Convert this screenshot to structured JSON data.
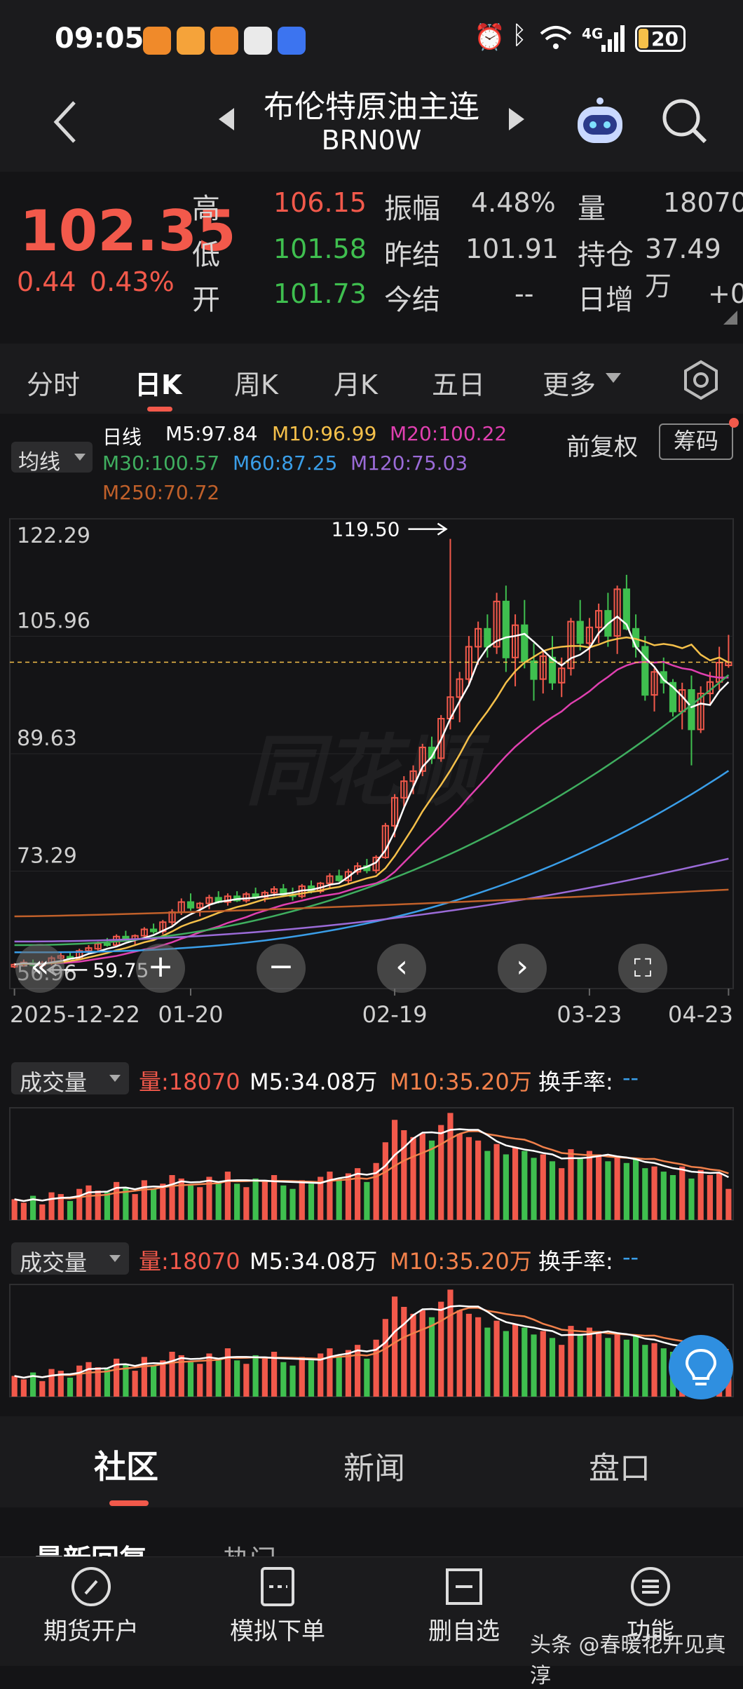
{
  "status_bar": {
    "time": "09:05",
    "network": "4G",
    "battery": "20"
  },
  "header": {
    "title": "布伦特原油主连",
    "code": "BRN0W"
  },
  "quote": {
    "price": "102.35",
    "change": "0.44",
    "change_pct": "0.43%",
    "high_label": "高",
    "high": "106.15",
    "low_label": "低",
    "low": "101.58",
    "open_label": "开",
    "open": "101.73",
    "amplitude_label": "振幅",
    "amplitude": "4.48%",
    "prev_settle_label": "昨结",
    "prev_settle": "101.91",
    "settle_label": "今结",
    "settle": "--",
    "volume_label": "量",
    "volume": "18070",
    "oi_label": "持仓",
    "oi": "37.49万",
    "daily_inc_label": "日增",
    "daily_inc": "+0"
  },
  "tabs": [
    "分时",
    "日K",
    "周K",
    "月K",
    "五日",
    "更多"
  ],
  "active_tab": "日K",
  "chart_controls": {
    "ma_select": "均线",
    "period": "日线",
    "adjust": "前复权",
    "chips": "筹码"
  },
  "ma_legend": {
    "m5": "M5:97.84",
    "m10": "M10:96.99",
    "m20": "M20:100.22",
    "m30": "M30:100.57",
    "m60": "M60:87.25",
    "m120": "M120:75.03",
    "m250": "M250:70.72"
  },
  "colors": {
    "up": "#f2594b",
    "down": "#3fbf4f",
    "m5": "#ffffff",
    "m10": "#f5c04a",
    "m20": "#e040b0",
    "m30": "#3fae5f",
    "m60": "#3a9ee8",
    "m120": "#9b6bd8",
    "m250": "#c0602a"
  },
  "watermark": "同花顺",
  "price_axis": {
    "ticks": [
      "122.29",
      "105.96",
      "89.63",
      "73.29",
      "56.96"
    ]
  },
  "annotations": {
    "max": "119.50",
    "min": "59.75"
  },
  "date_axis": [
    "2025-12-22",
    "01-20",
    "02-19",
    "03-23",
    "04-23"
  ],
  "volume_panel": {
    "label": "成交量",
    "vol": "量:18070",
    "m5": "M5:34.08万",
    "m10": "M10:35.20万",
    "turnover_label": "换手率:",
    "turnover": "--"
  },
  "chart_data": {
    "type": "candlestick",
    "y_range": [
      56.96,
      122.29
    ],
    "x_ticks": [
      "2025-12-22",
      "01-20",
      "02-19",
      "03-23",
      "04-23"
    ],
    "candles": [
      [
        60,
        60.5,
        59.8,
        60.3
      ],
      [
        60.3,
        61,
        60,
        60.6
      ],
      [
        60.5,
        61,
        60,
        60.2
      ],
      [
        60.2,
        60.8,
        59.75,
        60.5
      ],
      [
        60.5,
        61.5,
        60.2,
        61.2
      ],
      [
        61.2,
        62,
        60.8,
        61.5
      ],
      [
        61.4,
        62,
        61,
        61.1
      ],
      [
        61.1,
        62.5,
        61,
        62.2
      ],
      [
        62.2,
        63,
        61.8,
        62.6
      ],
      [
        62.5,
        63.5,
        62.2,
        63.2
      ],
      [
        63.2,
        64,
        62.8,
        63
      ],
      [
        63,
        64.5,
        62.8,
        64.2
      ],
      [
        64.2,
        65,
        63.5,
        63.8
      ],
      [
        63.8,
        64.5,
        63,
        64.3
      ],
      [
        64.3,
        65.5,
        64,
        65.2
      ],
      [
        65.2,
        66,
        64.6,
        64.9
      ],
      [
        64.9,
        66.5,
        64.5,
        66.2
      ],
      [
        66.2,
        68,
        65.8,
        67.6
      ],
      [
        67.6,
        69.5,
        67.2,
        69
      ],
      [
        69,
        70.2,
        67.8,
        68.2
      ],
      [
        68.2,
        69,
        67,
        68.8
      ],
      [
        68.8,
        70,
        68,
        69.6
      ],
      [
        69.6,
        70.5,
        68.8,
        69
      ],
      [
        69,
        70.2,
        68.5,
        69.8
      ],
      [
        69.8,
        70.5,
        69,
        69.2
      ],
      [
        69.2,
        70.4,
        68.9,
        70.1
      ],
      [
        70.1,
        71,
        69.4,
        69.7
      ],
      [
        69.7,
        70.6,
        69,
        70.3
      ],
      [
        70.3,
        71.2,
        69.8,
        70.8
      ],
      [
        70.8,
        71.5,
        69.8,
        70
      ],
      [
        70,
        71,
        69.2,
        69.8
      ],
      [
        69.8,
        71.5,
        69.5,
        71.2
      ],
      [
        71.2,
        72,
        70.2,
        70.5
      ],
      [
        70.5,
        71.8,
        70.2,
        71.6
      ],
      [
        71.6,
        73,
        71,
        72.6
      ],
      [
        72.6,
        73.5,
        71.8,
        72
      ],
      [
        72,
        73.6,
        71.5,
        73.2
      ],
      [
        73.2,
        74.5,
        72.8,
        74
      ],
      [
        74,
        75,
        73,
        73.4
      ],
      [
        73.4,
        75.5,
        73,
        75.2
      ],
      [
        75.2,
        80,
        75,
        79.6
      ],
      [
        79.6,
        84,
        78,
        83.5
      ],
      [
        83.5,
        86.5,
        82,
        85.8
      ],
      [
        85.8,
        88,
        84,
        87.2
      ],
      [
        87.2,
        91,
        86.5,
        90.5
      ],
      [
        90.5,
        92,
        88.2,
        89
      ],
      [
        89,
        95,
        88.5,
        94.5
      ],
      [
        94.5,
        119.5,
        93,
        97.5
      ],
      [
        97.5,
        101,
        94,
        100
      ],
      [
        100,
        106,
        99,
        104.5
      ],
      [
        104.5,
        108,
        102,
        107
      ],
      [
        107,
        109,
        103,
        104.5
      ],
      [
        104.5,
        112,
        103.5,
        110.8
      ],
      [
        110.8,
        113,
        101,
        103
      ],
      [
        103,
        109,
        99,
        107.5
      ],
      [
        107.5,
        111,
        101.5,
        102.5
      ],
      [
        102.5,
        105,
        97,
        100
      ],
      [
        100,
        104,
        98,
        103.2
      ],
      [
        103,
        106,
        98.5,
        99.5
      ],
      [
        99.5,
        103,
        97.5,
        101.5
      ],
      [
        101.5,
        108.5,
        100.5,
        108
      ],
      [
        108,
        111,
        104,
        105
      ],
      [
        105,
        108.5,
        102.5,
        107.2
      ],
      [
        107.2,
        110.5,
        105,
        109.5
      ],
      [
        109.5,
        112,
        104.5,
        106
      ],
      [
        106,
        113,
        103.5,
        112.5
      ],
      [
        112.5,
        114.5,
        106.8,
        107
      ],
      [
        107,
        109,
        103,
        104.5
      ],
      [
        104.5,
        106,
        97,
        97.8
      ],
      [
        97.8,
        101.5,
        95.5,
        101
      ],
      [
        101,
        103,
        98,
        99.5
      ],
      [
        99.5,
        100,
        94.8,
        95.5
      ],
      [
        95.5,
        99.5,
        93,
        98.5
      ],
      [
        98.5,
        100.5,
        88,
        93
      ],
      [
        93,
        99,
        92.5,
        98
      ],
      [
        98,
        101,
        96.5,
        99.6
      ],
      [
        99.6,
        104.5,
        98.5,
        102.3
      ],
      [
        101.91,
        106.15,
        101.58,
        102.35
      ]
    ],
    "volume": [
      12,
      10,
      14,
      9,
      16,
      15,
      11,
      18,
      20,
      17,
      16,
      22,
      19,
      15,
      23,
      18,
      21,
      26,
      24,
      20,
      19,
      25,
      22,
      28,
      21,
      19,
      24,
      22,
      26,
      20,
      18,
      23,
      21,
      25,
      28,
      24,
      27,
      30,
      22,
      33,
      45,
      58,
      52,
      48,
      50,
      46,
      55,
      62,
      50,
      48,
      46,
      40,
      44,
      38,
      42,
      40,
      36,
      38,
      34,
      30,
      41,
      36,
      40,
      38,
      34,
      36,
      33,
      35,
      30,
      31,
      28,
      26,
      31,
      24,
      29,
      26,
      27,
      18
    ],
    "ma_lines": {
      "m5": [
        60.3,
        60.5,
        60.4,
        60.4,
        60.6,
        60.8,
        61.1,
        61.3,
        61.8,
        62.1,
        62.5,
        62.8,
        63.3,
        63.7,
        64,
        64.4,
        65,
        65.6,
        66.6,
        67.3,
        67.9,
        68.6,
        69,
        69.2,
        69.4,
        69.5,
        69.6,
        69.8,
        70,
        70.1,
        70.3,
        70.6,
        70.7,
        71,
        71.4,
        71.6,
        72.5,
        73.5,
        73.9,
        74.5,
        76.2,
        78.8,
        82.1,
        85,
        87.8,
        89.2,
        91.6,
        94.5,
        96.9,
        99.2,
        102.5,
        104.4,
        105.3,
        105.8,
        106,
        106.3,
        105.2,
        104,
        102.8,
        101.9,
        102.9,
        103.4,
        104.3,
        106.4,
        107.7,
        108.7,
        107.6,
        104.5,
        103,
        101.7,
        99.9,
        98.9,
        97.6,
        96.1,
        96.6,
        96.4,
        98.3,
        99.6
      ],
      "m10": [
        60.3,
        60.4,
        60.4,
        60.4,
        60.5,
        60.6,
        60.8,
        61,
        61.3,
        61.6,
        61.9,
        62.3,
        62.6,
        63,
        63.4,
        63.7,
        64.3,
        64.9,
        65.6,
        66.1,
        66.5,
        67,
        67.5,
        67.9,
        68.3,
        68.6,
        69,
        69.4,
        69.6,
        69.8,
        70,
        70.2,
        70.4,
        70.6,
        70.9,
        71.1,
        71.5,
        71.9,
        72.3,
        72.6,
        73.7,
        75.4,
        77.4,
        79.4,
        81.6,
        83.5,
        85.3,
        87.3,
        89.5,
        91.9,
        93.8,
        95.5,
        97.4,
        99.5,
        101.1,
        102.3,
        103.1,
        103.9,
        104.3,
        104.5,
        104.6,
        104.6,
        104.4,
        104.8,
        105.3,
        105.6,
        105.8,
        105.6,
        105.2,
        104.7,
        104.9,
        104.7,
        104.3,
        104.8,
        103.4,
        102.6,
        103,
        102.3
      ],
      "m20": [
        60.3,
        60.4,
        60.4,
        60.4,
        60.5,
        60.5,
        60.6,
        60.7,
        60.9,
        61.1,
        61.3,
        61.5,
        61.8,
        62.1,
        62.4,
        62.6,
        63,
        63.4,
        63.9,
        64.3,
        64.8,
        65.2,
        65.6,
        66.1,
        66.5,
        66.9,
        67.4,
        67.8,
        68.2,
        68.6,
        68.9,
        69.2,
        69.5,
        69.8,
        70,
        70.2,
        70.6,
        71,
        71.3,
        71.6,
        72.2,
        73.2,
        74.5,
        75.8,
        77.1,
        78.3,
        79.5,
        80.8,
        82.1,
        83.6,
        85,
        86.4,
        87.9,
        89.3,
        90.6,
        91.7,
        92.8,
        93.8,
        94.7,
        95.5,
        96.6,
        97.4,
        98.3,
        99.4,
        100.3,
        101.3,
        101.9,
        102.3,
        102.4,
        102.3,
        102.4,
        101.9,
        101.5,
        101.3,
        100.8,
        100.4,
        100.2,
        100.22
      ]
    }
  }
}
